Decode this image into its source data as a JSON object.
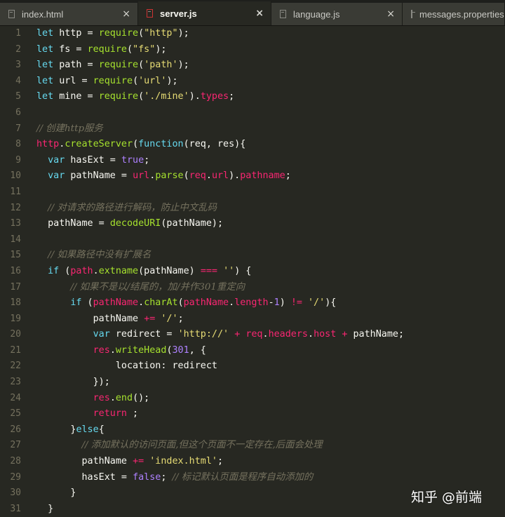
{
  "tabs": [
    {
      "label": "index.html",
      "close": "×",
      "active": false
    },
    {
      "label": "server.js",
      "close": "×",
      "active": true
    },
    {
      "label": "language.js",
      "close": "×",
      "active": false
    },
    {
      "label": "messages.properties",
      "close": "",
      "active": false
    }
  ],
  "lines": [
    {
      "n": "1",
      "t": [
        [
          "k",
          "let"
        ],
        [
          "",
          "&nbsp;http = "
        ],
        [
          "f",
          "require"
        ],
        [
          "",
          "("
        ],
        [
          "s",
          "\"http\""
        ],
        [
          "",
          ");"
        ]
      ]
    },
    {
      "n": "2",
      "t": [
        [
          "k",
          "let"
        ],
        [
          "",
          "&nbsp;fs = "
        ],
        [
          "f",
          "require"
        ],
        [
          "",
          "("
        ],
        [
          "s",
          "\"fs\""
        ],
        [
          "",
          ");"
        ]
      ]
    },
    {
      "n": "3",
      "t": [
        [
          "k",
          "let"
        ],
        [
          "",
          "&nbsp;path = "
        ],
        [
          "f",
          "require"
        ],
        [
          "",
          "("
        ],
        [
          "s",
          "'path'"
        ],
        [
          "",
          ");"
        ]
      ]
    },
    {
      "n": "4",
      "t": [
        [
          "k",
          "let"
        ],
        [
          "",
          "&nbsp;url = "
        ],
        [
          "f",
          "require"
        ],
        [
          "",
          "("
        ],
        [
          "s",
          "'url'"
        ],
        [
          "",
          ");"
        ]
      ]
    },
    {
      "n": "5",
      "t": [
        [
          "k",
          "let"
        ],
        [
          "",
          "&nbsp;mine = "
        ],
        [
          "f",
          "require"
        ],
        [
          "",
          "("
        ],
        [
          "s",
          "'./mine'"
        ],
        [
          "",
          ")."
        ],
        [
          "p",
          "types"
        ],
        [
          "",
          ";"
        ]
      ]
    },
    {
      "n": "6",
      "t": []
    },
    {
      "n": "7",
      "t": [
        [
          "c",
          "// 创建http服务"
        ]
      ]
    },
    {
      "n": "8",
      "t": [
        [
          "p",
          "http"
        ],
        [
          "",
          "."
        ],
        [
          "f",
          "createServer"
        ],
        [
          "",
          "("
        ],
        [
          "k",
          "function"
        ],
        [
          "",
          "(req, res){"
        ]
      ]
    },
    {
      "n": "9",
      "t": [
        [
          "",
          "&nbsp;&nbsp;"
        ],
        [
          "k",
          "var"
        ],
        [
          "",
          "&nbsp;hasExt = "
        ],
        [
          "n",
          "true"
        ],
        [
          "",
          ";"
        ]
      ]
    },
    {
      "n": "10",
      "t": [
        [
          "",
          "&nbsp;&nbsp;"
        ],
        [
          "k",
          "var"
        ],
        [
          "",
          "&nbsp;pathName = "
        ],
        [
          "p",
          "url"
        ],
        [
          "",
          "."
        ],
        [
          "f",
          "parse"
        ],
        [
          "",
          "("
        ],
        [
          "p",
          "req"
        ],
        [
          "",
          "."
        ],
        [
          "p",
          "url"
        ],
        [
          "",
          ")."
        ],
        [
          "p",
          "pathname"
        ],
        [
          "",
          ";"
        ]
      ]
    },
    {
      "n": "11",
      "t": []
    },
    {
      "n": "12",
      "t": [
        [
          "",
          "&nbsp;&nbsp;"
        ],
        [
          "c",
          "// 对请求的路径进行解码，防止中文乱码"
        ]
      ]
    },
    {
      "n": "13",
      "t": [
        [
          "",
          "&nbsp;&nbsp;pathName = "
        ],
        [
          "f",
          "decodeURI"
        ],
        [
          "",
          "(pathName);"
        ]
      ]
    },
    {
      "n": "14",
      "t": []
    },
    {
      "n": "15",
      "t": [
        [
          "",
          "&nbsp;&nbsp;"
        ],
        [
          "c",
          "// 如果路径中没有扩展名"
        ]
      ]
    },
    {
      "n": "16",
      "t": [
        [
          "",
          "&nbsp;&nbsp;"
        ],
        [
          "k",
          "if"
        ],
        [
          "",
          "&nbsp;("
        ],
        [
          "p",
          "path"
        ],
        [
          "",
          "."
        ],
        [
          "f",
          "extname"
        ],
        [
          "",
          "(pathName) "
        ],
        [
          "p",
          "==="
        ],
        [
          "",
          "&nbsp;"
        ],
        [
          "s",
          "''"
        ],
        [
          "",
          ") {"
        ]
      ]
    },
    {
      "n": "17",
      "t": [
        [
          "",
          "&nbsp;&nbsp;&nbsp;&nbsp;&nbsp;&nbsp;"
        ],
        [
          "c",
          "// 如果不是以/结尾的，加/并作301重定向"
        ]
      ]
    },
    {
      "n": "18",
      "t": [
        [
          "",
          "&nbsp;&nbsp;&nbsp;&nbsp;&nbsp;&nbsp;"
        ],
        [
          "k",
          "if"
        ],
        [
          "",
          "&nbsp;("
        ],
        [
          "p",
          "pathName"
        ],
        [
          "",
          "."
        ],
        [
          "f",
          "charAt"
        ],
        [
          "",
          "("
        ],
        [
          "p",
          "pathName"
        ],
        [
          "",
          "."
        ],
        [
          "p",
          "length"
        ],
        [
          "",
          "-"
        ],
        [
          "n",
          "1"
        ],
        [
          "",
          ") "
        ],
        [
          "p",
          "!="
        ],
        [
          "",
          "&nbsp;"
        ],
        [
          "s",
          "'/'"
        ],
        [
          "",
          "){"
        ]
      ]
    },
    {
      "n": "19",
      "t": [
        [
          "",
          "&nbsp;&nbsp;&nbsp;&nbsp;&nbsp;&nbsp;&nbsp;&nbsp;&nbsp;&nbsp;pathName "
        ],
        [
          "p",
          "+="
        ],
        [
          "",
          "&nbsp;"
        ],
        [
          "s",
          "'/'"
        ],
        [
          "",
          ";"
        ]
      ]
    },
    {
      "n": "20",
      "t": [
        [
          "",
          "&nbsp;&nbsp;&nbsp;&nbsp;&nbsp;&nbsp;&nbsp;&nbsp;&nbsp;&nbsp;"
        ],
        [
          "k",
          "var"
        ],
        [
          "",
          "&nbsp;redirect = "
        ],
        [
          "s",
          "'http://'"
        ],
        [
          "",
          "&nbsp;"
        ],
        [
          "p",
          "+"
        ],
        [
          "",
          "&nbsp;"
        ],
        [
          "p",
          "req"
        ],
        [
          "",
          "."
        ],
        [
          "p",
          "headers"
        ],
        [
          "",
          "."
        ],
        [
          "p",
          "host"
        ],
        [
          "",
          "&nbsp;"
        ],
        [
          "p",
          "+"
        ],
        [
          "",
          "&nbsp;pathName;"
        ]
      ]
    },
    {
      "n": "21",
      "t": [
        [
          "",
          "&nbsp;&nbsp;&nbsp;&nbsp;&nbsp;&nbsp;&nbsp;&nbsp;&nbsp;&nbsp;"
        ],
        [
          "p",
          "res"
        ],
        [
          "",
          "."
        ],
        [
          "f",
          "writeHead"
        ],
        [
          "",
          "("
        ],
        [
          "n",
          "301"
        ],
        [
          "",
          ", {"
        ]
      ]
    },
    {
      "n": "22",
      "t": [
        [
          "",
          "&nbsp;&nbsp;&nbsp;&nbsp;&nbsp;&nbsp;&nbsp;&nbsp;&nbsp;&nbsp;&nbsp;&nbsp;&nbsp;&nbsp;location: redirect"
        ]
      ]
    },
    {
      "n": "23",
      "t": [
        [
          "",
          "&nbsp;&nbsp;&nbsp;&nbsp;&nbsp;&nbsp;&nbsp;&nbsp;&nbsp;&nbsp;});"
        ]
      ]
    },
    {
      "n": "24",
      "t": [
        [
          "",
          "&nbsp;&nbsp;&nbsp;&nbsp;&nbsp;&nbsp;&nbsp;&nbsp;&nbsp;&nbsp;"
        ],
        [
          "p",
          "res"
        ],
        [
          "",
          "."
        ],
        [
          "f",
          "end"
        ],
        [
          "",
          "();"
        ]
      ]
    },
    {
      "n": "25",
      "t": [
        [
          "",
          "&nbsp;&nbsp;&nbsp;&nbsp;&nbsp;&nbsp;&nbsp;&nbsp;&nbsp;&nbsp;"
        ],
        [
          "p",
          "return"
        ],
        [
          "",
          "&nbsp;;"
        ]
      ]
    },
    {
      "n": "26",
      "t": [
        [
          "",
          "&nbsp;&nbsp;&nbsp;&nbsp;&nbsp;&nbsp;}"
        ],
        [
          "k",
          "else"
        ],
        [
          "",
          "{"
        ]
      ]
    },
    {
      "n": "27",
      "t": [
        [
          "",
          "&nbsp;&nbsp;&nbsp;&nbsp;&nbsp;&nbsp;&nbsp;&nbsp;"
        ],
        [
          "c",
          "// 添加默认的访问页面,但这个页面不一定存在,后面会处理"
        ]
      ]
    },
    {
      "n": "28",
      "t": [
        [
          "",
          "&nbsp;&nbsp;&nbsp;&nbsp;&nbsp;&nbsp;&nbsp;&nbsp;pathName "
        ],
        [
          "p",
          "+="
        ],
        [
          "",
          "&nbsp;"
        ],
        [
          "s",
          "'index.html'"
        ],
        [
          "",
          ";"
        ]
      ]
    },
    {
      "n": "29",
      "t": [
        [
          "",
          "&nbsp;&nbsp;&nbsp;&nbsp;&nbsp;&nbsp;&nbsp;&nbsp;hasExt = "
        ],
        [
          "n",
          "false"
        ],
        [
          "",
          "; "
        ],
        [
          "c",
          "// 标记默认页面是程序自动添加的"
        ]
      ]
    },
    {
      "n": "30",
      "t": [
        [
          "",
          "&nbsp;&nbsp;&nbsp;&nbsp;&nbsp;&nbsp;}"
        ]
      ]
    },
    {
      "n": "31",
      "t": [
        [
          "",
          "&nbsp;&nbsp;}"
        ]
      ]
    }
  ],
  "watermark": "知乎 @前端",
  "colors": {
    "background": "#272822",
    "keyword": "#66d9ef",
    "operator": "#f92672",
    "string": "#e6db74",
    "function": "#a6e22e",
    "number": "#ae81ff",
    "comment": "#75715e"
  }
}
